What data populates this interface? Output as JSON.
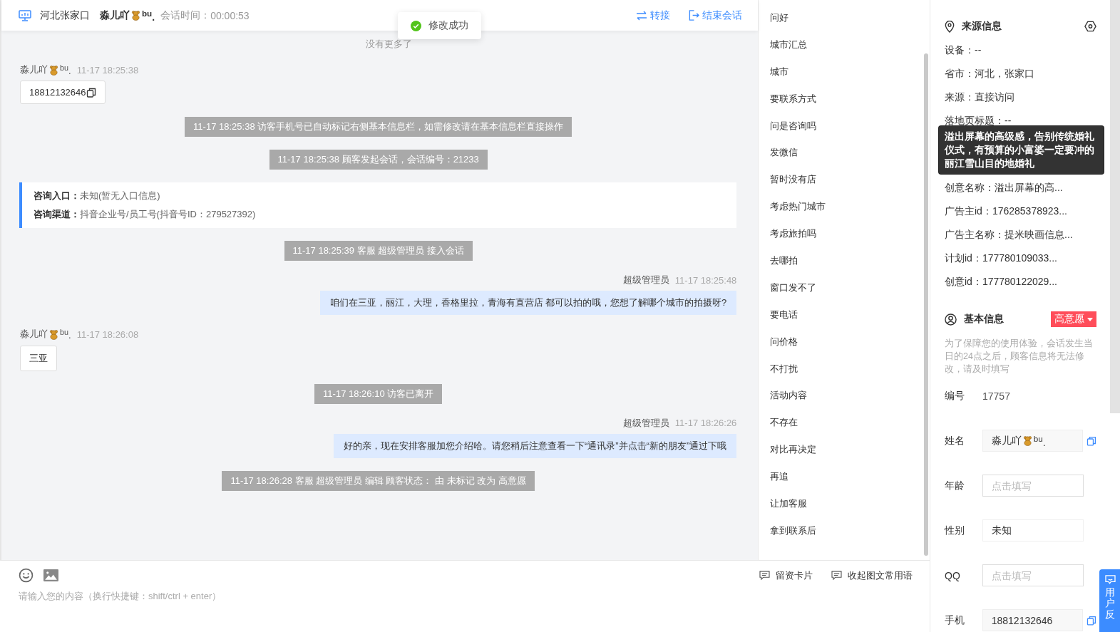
{
  "header": {
    "location": "河北张家口",
    "visitor_name": "淼儿吖",
    "visitor_suffix": "$^{bu}$.",
    "session_time_label": "会话时间：",
    "session_time": "00:00:53",
    "actions": [
      {
        "label": "转接",
        "kind": "transfer"
      },
      {
        "label": "结束会话",
        "kind": "end"
      }
    ]
  },
  "toast": {
    "text": "修改成功"
  },
  "chat": {
    "no_more": "没有更多了",
    "messages": [
      {
        "kind": "customer",
        "name": "淼儿吖",
        "suffix": "$^{bu}$.",
        "time": "11-17 18:25:38",
        "text": "18812132646",
        "copyable": true
      },
      {
        "kind": "system",
        "text": "11-17 18:25:38 访客手机号已自动标记右侧基本信息栏，如需修改请在基本信息栏直接操作"
      },
      {
        "kind": "system",
        "text": "11-17 18:25:38 顾客发起会话，会话编号：21233"
      },
      {
        "kind": "entry",
        "lines": [
          {
            "label": "咨询入口：",
            "value": "未知(暂无入口信息)"
          },
          {
            "label": "咨询渠道：",
            "value": "抖音企业号/员工号(抖音号ID：279527392)"
          }
        ]
      },
      {
        "kind": "system",
        "text": "11-17 18:25:39 客服 超级管理员 接入会话"
      },
      {
        "kind": "agent",
        "name": "超级管理员",
        "time": "11-17 18:25:48",
        "text": "咱们在三亚，丽江，大理，香格里拉，青海有直营店 都可以拍的哦，您想了解哪个城市的拍摄呀?"
      },
      {
        "kind": "customer",
        "name": "淼儿吖",
        "suffix": "$^{bu}$.",
        "time": "11-17 18:26:08",
        "text": "三亚",
        "copyable": false
      },
      {
        "kind": "system",
        "text": "11-17 18:26:10 访客已离开"
      },
      {
        "kind": "agent",
        "name": "超级管理员",
        "time": "11-17 18:26:26",
        "text": "好的亲，现在安排客服加您介绍哈。请您稍后注意查看一下“通讯录”并点击“新的朋友”通过下哦"
      },
      {
        "kind": "system",
        "text": "11-17 18:26:28 客服 超级管理员 编辑 顾客状态： 由 未标记 改为 高意愿"
      }
    ]
  },
  "phrases": [
    "问好",
    "城市汇总",
    "城市",
    "要联系方式",
    "问是咨询吗",
    "发微信",
    "暂时没有店",
    "考虑热门城市",
    "考虑旅拍吗",
    "去哪拍",
    "窗口发不了",
    "要电话",
    "问价格",
    "不打扰",
    "活动内容",
    "不存在",
    "对比再决定",
    "再追",
    "让加客服",
    "拿到联系后"
  ],
  "composer": {
    "tools": [
      {
        "label": "留资卡片"
      },
      {
        "label": "收起图文常用语"
      }
    ],
    "placeholder": "请输入您的内容（换行快捷键：shift/ctrl + enter）"
  },
  "source_info": {
    "title": "来源信息",
    "rows": [
      {
        "kind": "row",
        "text": "设备：--"
      },
      {
        "kind": "row",
        "text": "省市：河北，张家口"
      },
      {
        "kind": "row",
        "text": "来源：直接访问"
      },
      {
        "kind": "row",
        "text": "落地页标题：--"
      },
      {
        "kind": "tooltip",
        "text": "溢出屏幕的高级感，告别传统婚礼仪式，有预算的小富婆一定要冲的丽江雪山目的地婚礼"
      },
      {
        "kind": "row",
        "text": "创意名称：溢出屏幕的高..."
      },
      {
        "kind": "row",
        "text": "广告主id：176285378923..."
      },
      {
        "kind": "row",
        "text": "广告主名称：提米映画信息..."
      },
      {
        "kind": "row",
        "text": "计划id：177780109033..."
      },
      {
        "kind": "row",
        "text": "创意id：177780122029..."
      }
    ]
  },
  "basic_info": {
    "title": "基本信息",
    "status": "高意愿",
    "note": "为了保障您的使用体验，会话发生当日的24点之后，顾客信息将无法修改，请及时填写",
    "fields": [
      {
        "label": "编号",
        "kind": "text",
        "value": "17757"
      },
      {
        "label": "姓名",
        "kind": "name",
        "value": "淼儿吖",
        "suffix": "$^{bu}$."
      },
      {
        "label": "年龄",
        "kind": "input",
        "placeholder": "点击填写"
      },
      {
        "label": "性别",
        "kind": "input",
        "value": "未知"
      },
      {
        "label": "QQ",
        "kind": "input",
        "placeholder": "点击填写"
      },
      {
        "label": "手机",
        "kind": "copy",
        "value": "18812132646"
      }
    ]
  },
  "feedback": {
    "label": "用户反"
  }
}
